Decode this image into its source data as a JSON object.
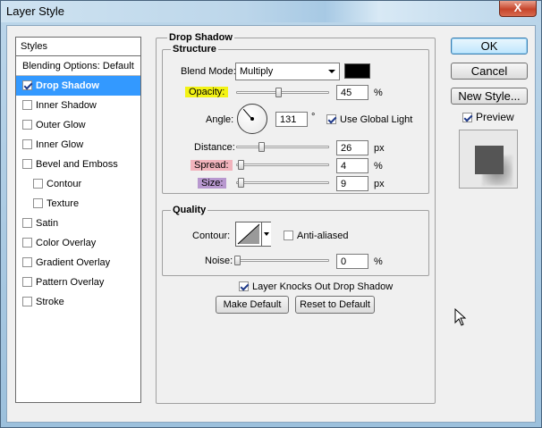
{
  "window": {
    "title": "Layer Style",
    "close_label": "X"
  },
  "styles": {
    "header": "Styles",
    "blending_label": "Blending Options: Default",
    "items": [
      {
        "label": "Drop Shadow",
        "checked": true
      },
      {
        "label": "Inner Shadow",
        "checked": false
      },
      {
        "label": "Outer Glow",
        "checked": false
      },
      {
        "label": "Inner Glow",
        "checked": false
      },
      {
        "label": "Bevel and Emboss",
        "checked": false
      },
      {
        "label": "Contour",
        "checked": false
      },
      {
        "label": "Texture",
        "checked": false
      },
      {
        "label": "Satin",
        "checked": false
      },
      {
        "label": "Color Overlay",
        "checked": false
      },
      {
        "label": "Gradient Overlay",
        "checked": false
      },
      {
        "label": "Pattern Overlay",
        "checked": false
      },
      {
        "label": "Stroke",
        "checked": false
      }
    ]
  },
  "drop_shadow": {
    "title": "Drop Shadow",
    "structure_title": "Structure",
    "blend_mode_label": "Blend Mode:",
    "blend_mode_value": "Multiply",
    "shadow_color": "#000000",
    "opacity_label": "Opacity:",
    "opacity_value": "45",
    "opacity_unit": "%",
    "opacity_fraction": 0.45,
    "angle_label": "Angle:",
    "angle_value": "131",
    "angle_unit": "°",
    "use_global_light_label": "Use Global Light",
    "use_global_light_checked": true,
    "distance_label": "Distance:",
    "distance_value": "26",
    "distance_unit": "px",
    "distance_fraction": 0.26,
    "spread_label": "Spread:",
    "spread_value": "4",
    "spread_unit": "%",
    "spread_fraction": 0.04,
    "size_label": "Size:",
    "size_value": "9",
    "size_unit": "px",
    "size_fraction": 0.04,
    "quality_title": "Quality",
    "contour_label": "Contour:",
    "anti_aliased_label": "Anti-aliased",
    "anti_aliased_checked": false,
    "noise_label": "Noise:",
    "noise_value": "0",
    "noise_unit": "%",
    "noise_fraction": 0,
    "knockout_label": "Layer Knocks Out Drop Shadow",
    "knockout_checked": true,
    "make_default_label": "Make Default",
    "reset_default_label": "Reset to Default"
  },
  "actions": {
    "ok_label": "OK",
    "cancel_label": "Cancel",
    "new_style_label": "New Style...",
    "preview_label": "Preview",
    "preview_checked": true
  },
  "colors": {
    "selection": "#3399ff",
    "opacity_highlight": "#f3f315",
    "spread_highlight": "#f1b3bc",
    "size_highlight": "#b898cf"
  }
}
